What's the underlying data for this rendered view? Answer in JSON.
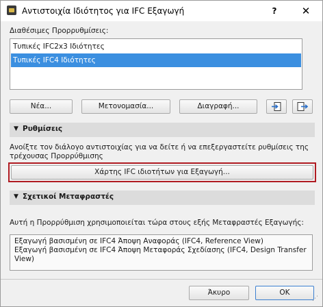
{
  "window": {
    "title": "Αντιστοιχία Ιδιότητος για IFC Εξαγωγή",
    "help_label": "?",
    "close_label": "✕"
  },
  "presets": {
    "label": "Διαθέσιμες Προρρυθμίσεις:",
    "items": [
      {
        "label": "Τυπικές IFC2x3 Ιδιότητες",
        "selected": false
      },
      {
        "label": "Τυπικές IFC4 Ιδιότητες",
        "selected": true
      }
    ],
    "new_label": "Νέα...",
    "rename_label": "Μετονομασία...",
    "delete_label": "Διαγραφή..."
  },
  "settings": {
    "title": "Ρυθμίσεις",
    "description_line1": "Ανοίξτε τον διάλογο αντιστοιχίας για να δείτε ή να επεξεργαστείτε ρυθμίσεις της",
    "description_line2": "τρέχουσας Προρρύθμισης",
    "map_button_label": "Χάρτης IFC ιδιοτήτων για Εξαγωγή..."
  },
  "translators": {
    "title": "Σχετικοί Μεταφραστές",
    "intro": "Αυτή η Προρρύθμιση χρησιμοποιείται τώρα στους εξής Μεταφραστές Εξαγωγής:",
    "lines": [
      "Εξαγωγή βασισμένη σε IFC4 Άποψη Αναφοράς (IFC4, Reference View)",
      "Εξαγωγή βασισμένη σε IFC4 Άποψη Μεταφοράς Σχεδίασης (IFC4, Design Transfer",
      "View)"
    ]
  },
  "footer": {
    "cancel_label": "Άκυρο",
    "ok_label": "OK"
  },
  "colors": {
    "selection": "#3b8fe0",
    "highlight_border": "#b01b22",
    "ok_border": "#3b7fd0"
  }
}
